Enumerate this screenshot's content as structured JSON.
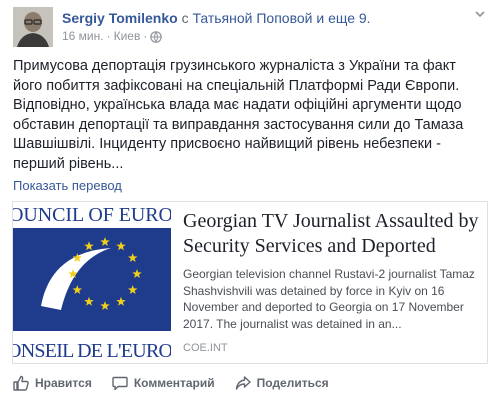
{
  "post": {
    "author": "Sergiy Tomilenko",
    "with_word": "с",
    "tagged": "Татьяной Поповой и еще 9.",
    "time": "16 мин.",
    "location": "Киев",
    "text": "Примусова депортація грузинського журналіста з України та факт його побиття зафіксовані на спеціальній Платформі Ради Європи. Відповідно, українська влада має надати офіційні аргументи щодо обставин депортації та виправдання застосування сили до Тамаза Шавшішвілі. Інциденту присвоєно найвищий рівень небезпеки - перший рівень...",
    "translate_link": "Показать перевод"
  },
  "card": {
    "image_text_top": "OUNCIL OF EURO",
    "image_text_bottom": "ONSEIL DE L'EURO",
    "title": "Georgian TV Journalist Assaulted by Security Services and Deported",
    "description": "Georgian television channel Rustavi-2 journalist Tamaz Shashvishvili was detained by force in Kyiv on 16 November and deported to Georgia on 17 November 2017. The journalist was detained in an...",
    "source": "COE.INT",
    "logo_blue": "#1f3b8c",
    "star_color": "#f2cf1a"
  },
  "actions": {
    "like": "Нравится",
    "comment": "Комментарий",
    "share": "Поделиться"
  }
}
